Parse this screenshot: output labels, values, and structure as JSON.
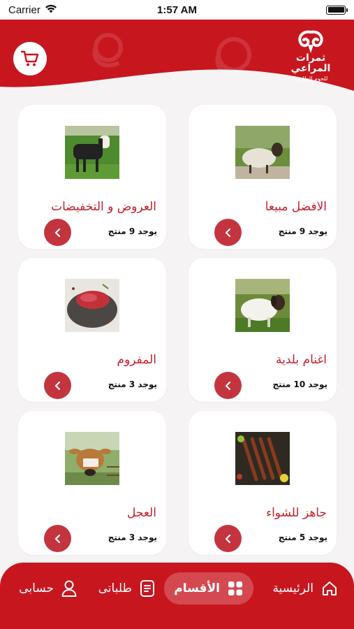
{
  "status_bar": {
    "carrier": "Carrier",
    "time": "1:57 AM"
  },
  "header": {
    "logo_title": "ثمرات المراعي",
    "logo_subtitle": "للحوم الطازجة",
    "cart_icon": "cart-icon",
    "brand_color": "#c8161f"
  },
  "categories": [
    {
      "title": "الافضل مبيعا",
      "count": "يوجد 9 منتج",
      "image": "sheep"
    },
    {
      "title": "العروض و التخفيضات",
      "count": "يوجد 9 منتج",
      "image": "goat"
    },
    {
      "title": "اغنام بلدية",
      "count": "يوجد 10 منتج",
      "image": "sheep-white"
    },
    {
      "title": "المفروم",
      "count": "يوجد 3 منتج",
      "image": "minced-meat"
    },
    {
      "title": "جاهز للشواء",
      "count": "يوجد 5 منتج",
      "image": "skewers"
    },
    {
      "title": "العجل",
      "count": "يوجد 3 منتج",
      "image": "calf"
    }
  ],
  "bottom_nav": {
    "home": "الرئيسية",
    "categories": "الأقسام",
    "orders": "طلباتى",
    "account": "حسابى",
    "active": "categories"
  },
  "colors": {
    "accent": "#c3202e",
    "arrow_button": "#c3343f",
    "background": "#f5f3f3"
  }
}
